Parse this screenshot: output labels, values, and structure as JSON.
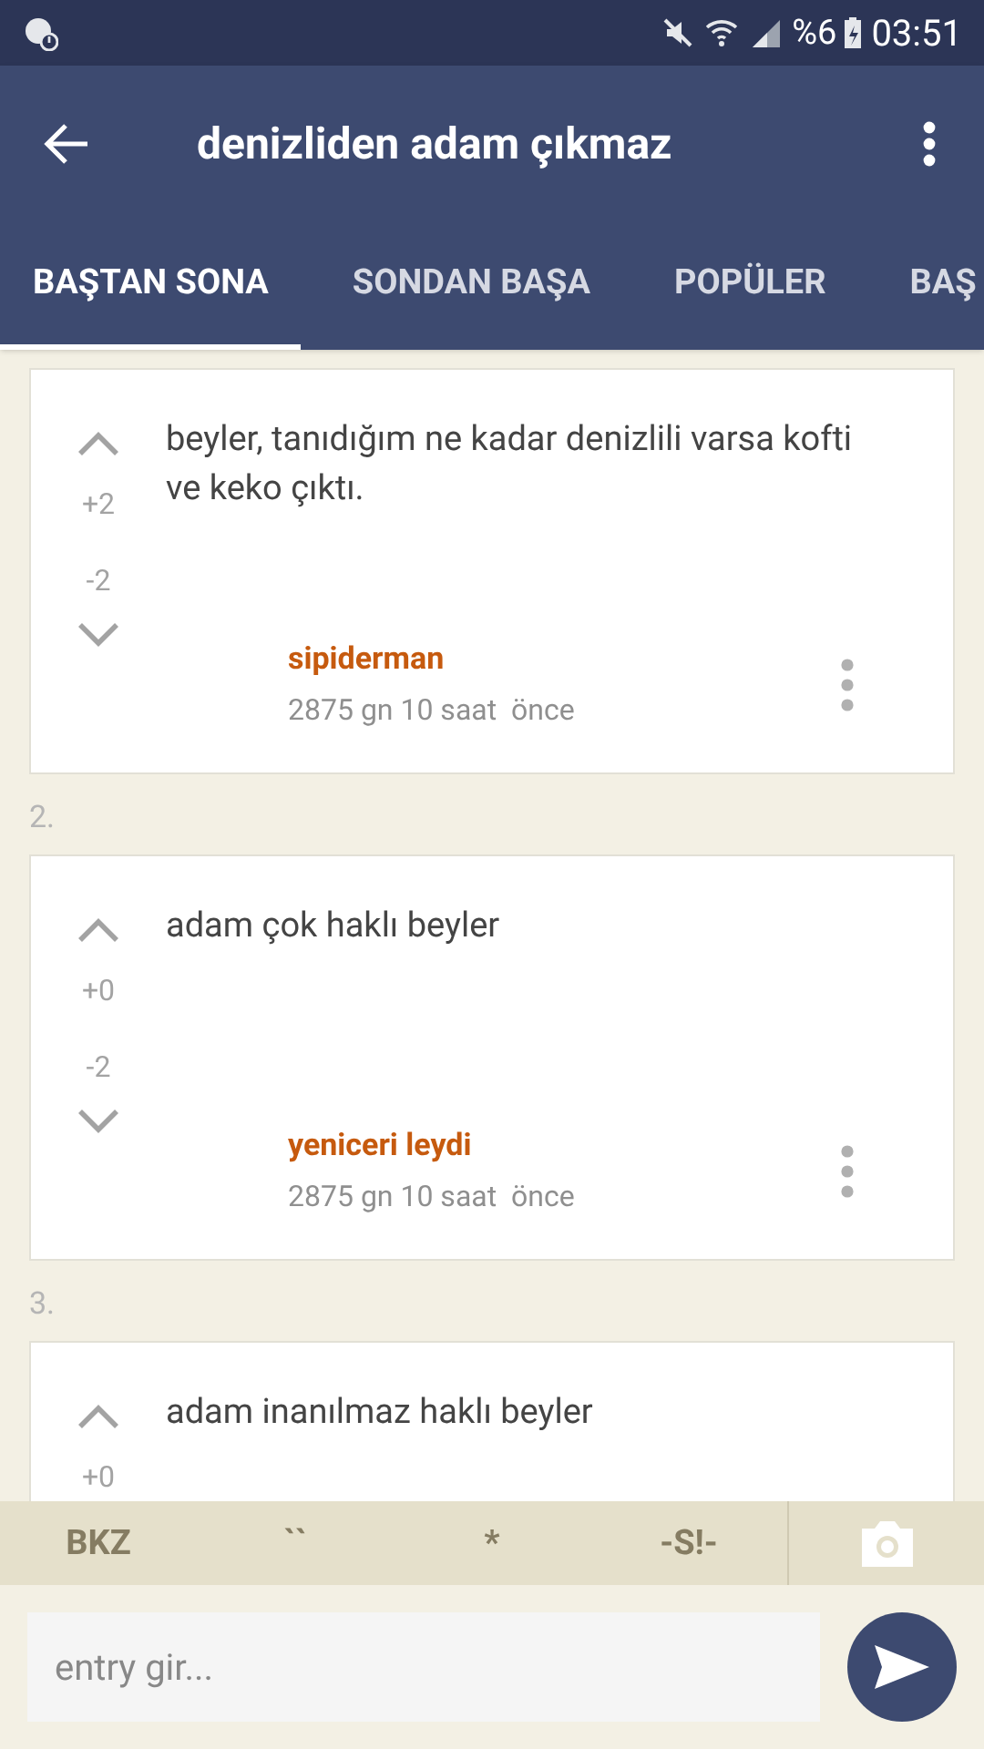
{
  "status_bar": {
    "battery": "%6",
    "time": "03:51"
  },
  "app_bar": {
    "title": "denizliden adam çıkmaz"
  },
  "tabs": [
    {
      "label": "BAŞTAN SONA",
      "selected": true
    },
    {
      "label": "SONDAN BAŞA",
      "selected": false
    },
    {
      "label": "POPÜLER",
      "selected": false
    },
    {
      "label": "BAŞ",
      "selected": false
    }
  ],
  "entries": [
    {
      "up_count": "+2",
      "down_count": "-2",
      "text": "beyler, tanıdığım ne kadar denizlili varsa kofti ve keko çıktı.",
      "author": "sipiderman",
      "time": "2875 gn 10 saat  önce"
    },
    {
      "number": "2.",
      "up_count": "+0",
      "down_count": "-2",
      "text": "adam çok haklı beyler",
      "author": "yeniceri leydi",
      "time": "2875 gn 10 saat  önce"
    },
    {
      "number": "3.",
      "up_count": "+0",
      "text": "adam inanılmaz haklı beyler"
    }
  ],
  "format_bar": [
    "BKZ",
    "``",
    "*",
    "-S!-"
  ],
  "composer": {
    "placeholder": "entry gir..."
  }
}
